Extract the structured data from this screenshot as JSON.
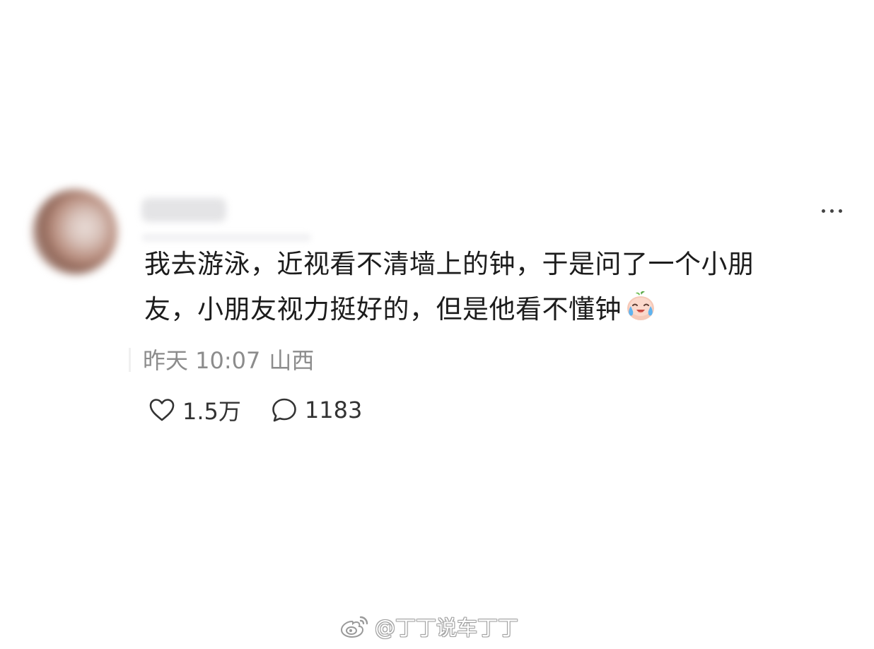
{
  "post": {
    "username": "",
    "more_icon": "more-horizontal-icon",
    "content_lines": [
      "我去游泳，近视看不清墙上的钟，于是问了一个小朋",
      "友，小朋友视力挺好的，但是他看不懂钟"
    ],
    "emoji": "crying-face-emoji-icon",
    "time": "昨天 10:07",
    "location": "山西",
    "likes": "1.5万",
    "comments": "1183",
    "like_icon": "heart-outline-icon",
    "comment_icon": "comment-bubble-icon"
  },
  "watermark": {
    "icon": "weibo-logo-icon",
    "text": "@丁丁说车丁丁"
  },
  "colors": {
    "background": "#ffffff",
    "text_primary": "#1c1c1c",
    "text_secondary": "#8c8c8c",
    "icon": "#333333"
  }
}
